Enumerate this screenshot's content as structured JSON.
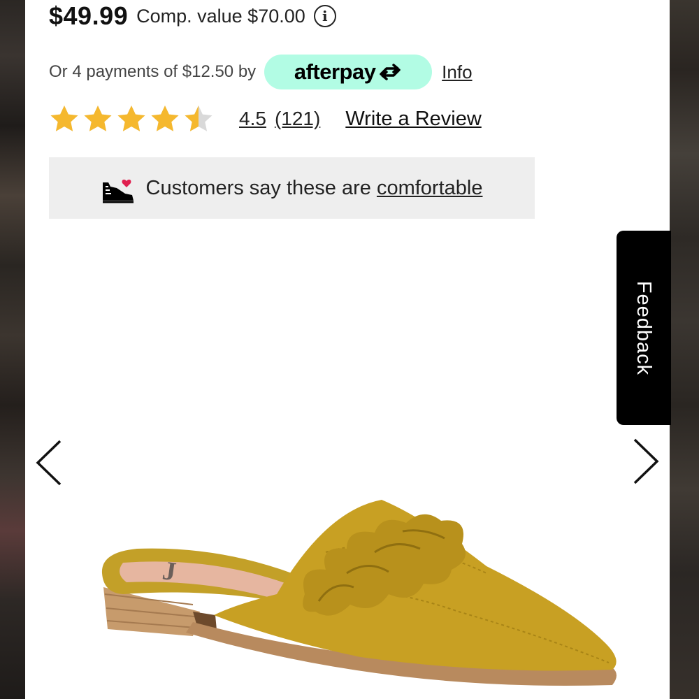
{
  "pricing": {
    "price": "$49.99",
    "comp_value": "Comp. value $70.00"
  },
  "afterpay": {
    "installment_text": "Or 4 payments of $12.50 by",
    "brand_name": "afterpay",
    "info_link": "Info",
    "badge_color": "#b2fce4"
  },
  "rating": {
    "average": "4.5",
    "count": "(121)",
    "stars_filled": 4.5,
    "stars_total": 5,
    "star_color": "#f5b82e",
    "write_review": "Write a Review"
  },
  "comfort": {
    "prefix": "Customers say these are",
    "link": "comfortable",
    "icon": "sneaker-heart-icon"
  },
  "carousel": {
    "prev_icon": "chevron-left-icon",
    "next_icon": "chevron-right-icon"
  },
  "feedback": {
    "label": "Feedback"
  }
}
